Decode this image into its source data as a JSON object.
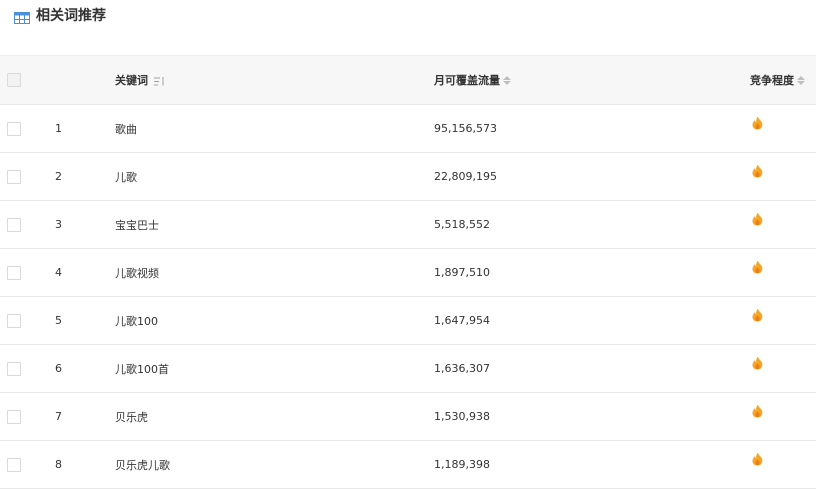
{
  "title": "相关词推荐",
  "columns": {
    "keyword": "关键词",
    "traffic": "月可覆盖流量",
    "competition": "竞争程度"
  },
  "rows": [
    {
      "index": "1",
      "keyword": "歌曲",
      "traffic": "95,156,573",
      "competition_icon": "fire-icon"
    },
    {
      "index": "2",
      "keyword": "儿歌",
      "traffic": "22,809,195",
      "competition_icon": "fire-icon"
    },
    {
      "index": "3",
      "keyword": "宝宝巴士",
      "traffic": "5,518,552",
      "competition_icon": "fire-icon"
    },
    {
      "index": "4",
      "keyword": "儿歌视频",
      "traffic": "1,897,510",
      "competition_icon": "fire-icon"
    },
    {
      "index": "5",
      "keyword": "儿歌100",
      "traffic": "1,647,954",
      "competition_icon": "fire-icon"
    },
    {
      "index": "6",
      "keyword": "儿歌100首",
      "traffic": "1,636,307",
      "competition_icon": "fire-icon"
    },
    {
      "index": "7",
      "keyword": "贝乐虎",
      "traffic": "1,530,938",
      "competition_icon": "fire-icon"
    },
    {
      "index": "8",
      "keyword": "贝乐虎儿歌",
      "traffic": "1,189,398",
      "competition_icon": "fire-icon"
    }
  ],
  "colors": {
    "accent_icon": "#4a90d9",
    "fire": "#f5a623",
    "header_bg": "#f7f7f7",
    "border": "#e8e8e8"
  }
}
